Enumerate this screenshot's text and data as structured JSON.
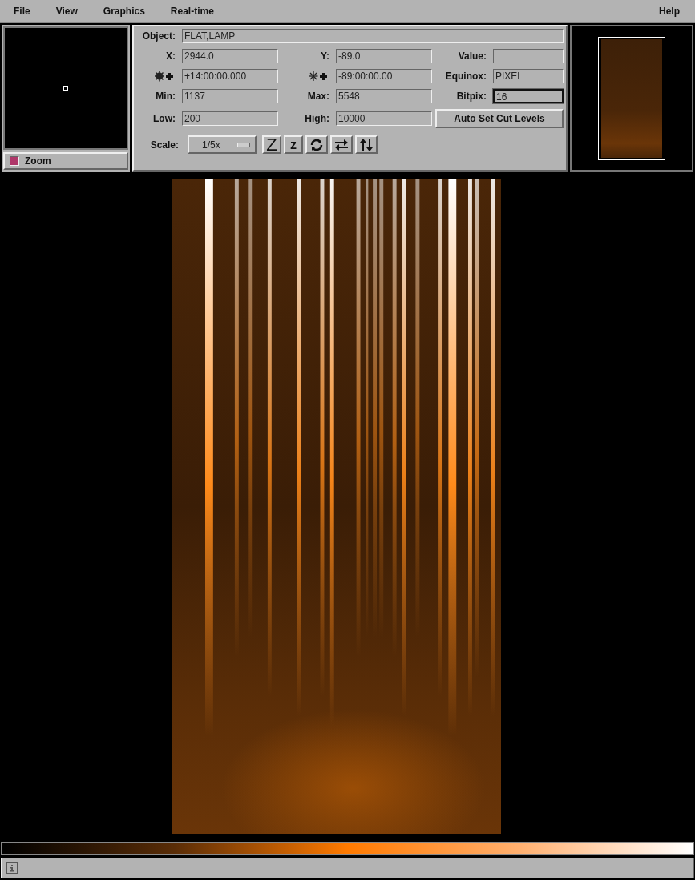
{
  "menu_bar": {
    "left": [
      "File",
      "View",
      "Graphics",
      "Real-time"
    ],
    "right": [
      "Help"
    ]
  },
  "zoom_panel": {
    "toggle": {
      "label": "Zoom",
      "checked": true
    }
  },
  "info_panel": {
    "rows": [
      [
        {
          "kind": "field",
          "label": "Object:",
          "value": "FLAT,LAMP",
          "wide": true
        }
      ],
      [
        {
          "kind": "field",
          "label": "X:",
          "value": "2944.0"
        },
        {
          "kind": "field",
          "label": "Y:",
          "value": "-89.0"
        },
        {
          "kind": "field",
          "label": "Value:"
        }
      ],
      [
        {
          "kind": "ra",
          "value": "+14:00:00.000"
        },
        {
          "kind": "dec",
          "value": "-89:00:00.00"
        },
        {
          "kind": "field",
          "label": "Equinox:",
          "value": "PIXEL"
        }
      ],
      [
        {
          "kind": "field",
          "label": "Min:",
          "value": "1137"
        },
        {
          "kind": "field",
          "label": "Max:",
          "value": "5548"
        },
        {
          "kind": "field",
          "label": "Bitpix:",
          "value": "16",
          "focused": true
        }
      ],
      [
        {
          "kind": "field",
          "label": "Low:",
          "value": "200"
        },
        {
          "kind": "field",
          "label": "High:",
          "value": "10000"
        },
        {
          "kind": "button",
          "label": "Auto Set Cut Levels"
        }
      ]
    ],
    "scale": {
      "label": "Scale:",
      "value": "1/5x"
    },
    "tools": [
      {
        "kind": "text",
        "label": "Z",
        "big": true
      },
      {
        "kind": "text",
        "label": "z"
      },
      {
        "kind": "rotate"
      },
      {
        "kind": "flip-x"
      },
      {
        "kind": "flip-y"
      }
    ]
  }
}
